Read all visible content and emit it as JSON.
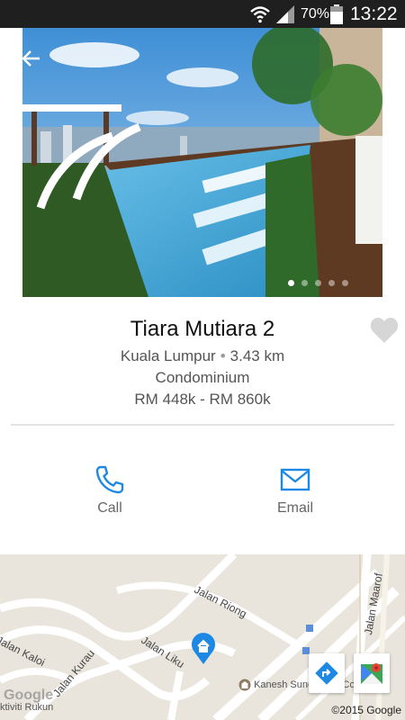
{
  "status_bar": {
    "battery_percent": "70%",
    "time": "13:22",
    "icons": [
      "wifi-icon",
      "signal-icon",
      "battery-icon"
    ]
  },
  "property": {
    "name": "Tiara Mutiara 2",
    "city": "Kuala Lumpur",
    "separator": "•",
    "distance": "3.43 km",
    "type": "Condominium",
    "price_range": "RM 448k - RM 860k",
    "photo_pager": {
      "total": 5,
      "active_index": 0
    },
    "favorite_icon": "heart-icon"
  },
  "actions": {
    "call_label": "Call",
    "email_label": "Email",
    "accent_color": "#1e88e5"
  },
  "map": {
    "streets": {
      "jalan_riong": "Jalan Riong",
      "jalan_kaloi": "Jalan Kaloi",
      "jalan_kurau": "Jalan Kurau",
      "jalan_liku": "Jalan Liku",
      "jalan_maarof": "Jalan Maarof"
    },
    "pois": {
      "kanesh": "Kanesh Sundrum & Co",
      "aktiviti": "ktiviti Rukun"
    },
    "google_logo": "Google",
    "copyright": "©2015 Google",
    "pin_color": "#1e88e5"
  }
}
